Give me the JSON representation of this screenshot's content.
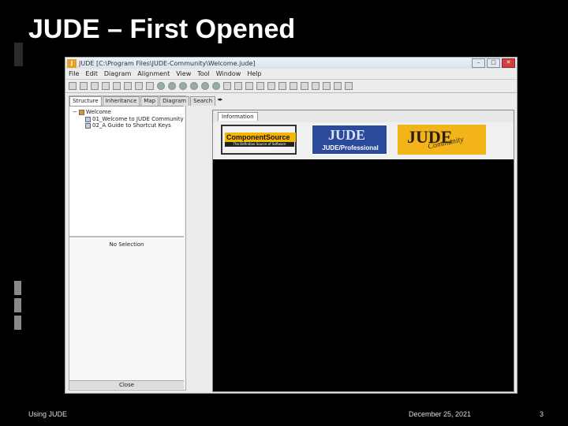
{
  "slide": {
    "title": "JUDE – First Opened",
    "footer_left": "Using JUDE",
    "footer_date": "December 25, 2021",
    "page_number": "3"
  },
  "window": {
    "icon_text": "J",
    "title": "JUDE  [C:\\Program Files\\JUDE-Community\\Welcome.jude]",
    "controls": {
      "minimize": "–",
      "maximize": "□",
      "close": "✕"
    },
    "menu": [
      "File",
      "Edit",
      "Diagram",
      "Alignment",
      "View",
      "Tool",
      "Window",
      "Help"
    ]
  },
  "left_panel": {
    "tabs": [
      "Structure",
      "Inheritance",
      "Map",
      "Diagram",
      "Search"
    ],
    "tree": {
      "root": "Welcome",
      "items": [
        "01_Welcome to JUDE Community",
        "02_A Guide to Shortcut Keys"
      ]
    },
    "properties": {
      "no_selection": "No Selection",
      "close_label": "Close"
    }
  },
  "right_panel": {
    "tab": "Information",
    "banners": [
      {
        "name": "componentsource",
        "text": "ComponentSource",
        "tagline": "The Definitive Source of Software Components"
      },
      {
        "name": "jude-professional",
        "logo": "JUDE",
        "text": "JUDE/Professional"
      },
      {
        "name": "jude-community",
        "logo": "JUDE",
        "sub": "Community"
      }
    ]
  },
  "colors": {
    "slide_bg": "#000000",
    "window_bg": "#ececec",
    "banner_gold": "#f2b418",
    "banner_blue": "#2a4a9c"
  }
}
